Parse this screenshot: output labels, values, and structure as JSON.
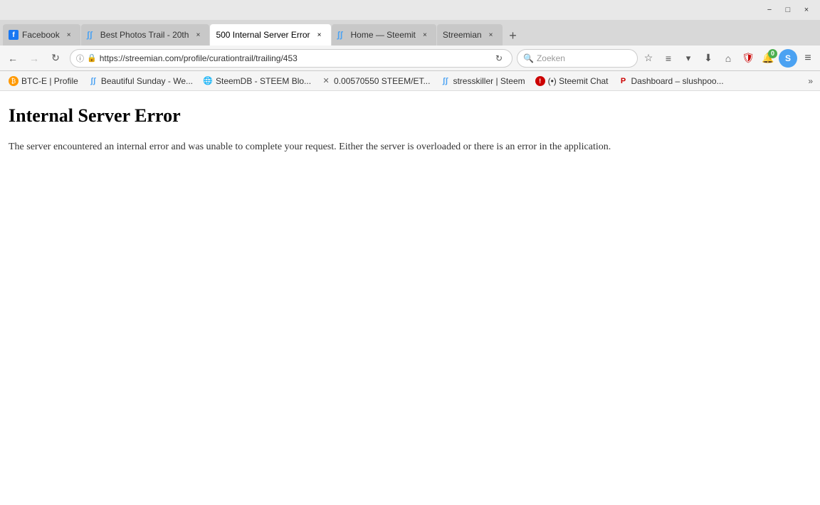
{
  "window": {
    "title": "500 Internal Server Error",
    "controls": {
      "minimize": "−",
      "maximize": "□",
      "close": "×"
    }
  },
  "tabs": [
    {
      "id": "facebook",
      "label": "Facebook",
      "favicon_type": "fb",
      "active": false,
      "closeable": true
    },
    {
      "id": "best-photos",
      "label": "Best Photos Trail - 20th",
      "favicon_type": "steemit",
      "active": false,
      "closeable": true
    },
    {
      "id": "internal-error",
      "label": "500 Internal Server Error",
      "favicon_type": "none",
      "active": true,
      "closeable": true
    },
    {
      "id": "home-steemit",
      "label": "Home — Steemit",
      "favicon_type": "steemit",
      "active": false,
      "closeable": true
    },
    {
      "id": "streemian",
      "label": "Streemian",
      "favicon_type": "none",
      "active": false,
      "closeable": true
    }
  ],
  "nav": {
    "back_disabled": false,
    "forward_disabled": true,
    "url": "https://streemian.com/profile/curationtrail/trailing/453",
    "search_placeholder": "Zoeken"
  },
  "bookmarks": [
    {
      "id": "btce",
      "label": "BTC-E | Profile",
      "icon": "₿"
    },
    {
      "id": "beautiful-sunday",
      "label": "Beautiful Sunday - We...",
      "icon": "ʃʃ"
    },
    {
      "id": "steemdb",
      "label": "SteemDB - STEEM Blo...",
      "icon": "🌐"
    },
    {
      "id": "steem-price",
      "label": "0.00570550 STEEM/ET...",
      "icon": "✕"
    },
    {
      "id": "stresskiller",
      "label": "stresskiller | Steem",
      "icon": "ʃʃ"
    },
    {
      "id": "steemit-chat",
      "label": "(•) Steemit Chat",
      "icon": "①"
    },
    {
      "id": "dashboard",
      "label": "Dashboard – slushpoo...",
      "icon": "P"
    }
  ],
  "page": {
    "error_title": "Internal Server Error",
    "error_message": "The server encountered an internal error and was unable to complete your request. Either the server is overloaded or there is an error in the application."
  },
  "toolbar_icons": {
    "star": "☆",
    "reading": "≡",
    "pocket": "⬇",
    "download": "⬇",
    "home": "⌂",
    "shield": "🛡",
    "notification": "🔔",
    "badge_count": "0",
    "profile": "S",
    "menu": "≡"
  }
}
